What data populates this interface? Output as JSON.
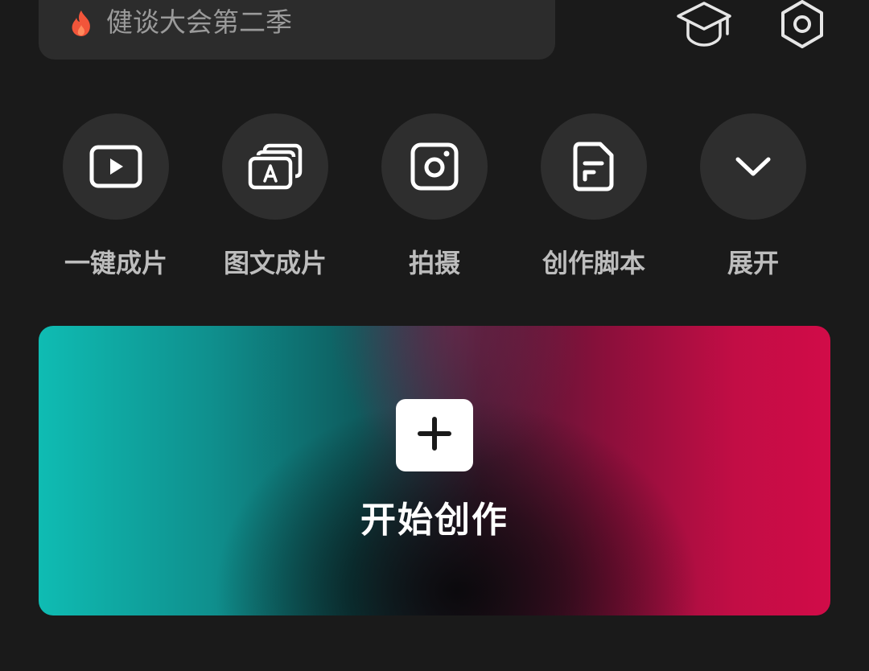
{
  "search": {
    "query": "健谈大会第二季",
    "flame_color": "#f2553a"
  },
  "top_icons": {
    "academy": "graduation-cap-icon",
    "settings": "settings-hexagon-icon"
  },
  "shortcuts": [
    {
      "label": "一键成片",
      "icon": "play-frame-icon"
    },
    {
      "label": "图文成片",
      "icon": "text-cards-icon"
    },
    {
      "label": "拍摄",
      "icon": "camera-icon"
    },
    {
      "label": "创作脚本",
      "icon": "script-document-icon"
    },
    {
      "label": "展开",
      "icon": "chevron-down-icon"
    }
  ],
  "create": {
    "label": "开始创作",
    "icon": "plus-icon",
    "gradient_start": "#0fbcb3",
    "gradient_end": "#d10c48"
  }
}
